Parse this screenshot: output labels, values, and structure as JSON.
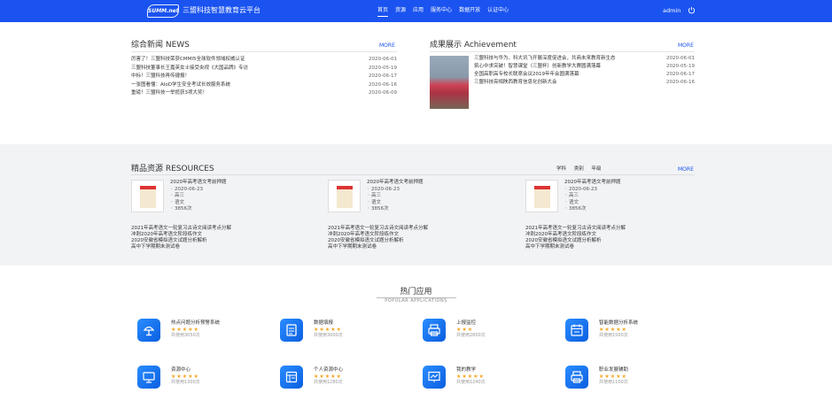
{
  "header": {
    "logo_text": "SUMM.net",
    "site_name": "三盟科技智慧教育云平台",
    "nav": [
      "首页",
      "资源",
      "应用",
      "服务中心",
      "数据开放",
      "认证中心"
    ],
    "active_nav": "首页",
    "user": "admin",
    "accent": "#1a53f0"
  },
  "news": {
    "title": "综合新闻 NEWS",
    "more": "MORE",
    "items": [
      {
        "title": "厉害了！三盟科技荣获CMMI5全球软件领域权威认证",
        "date": "2020-06-01"
      },
      {
        "title": "三盟科技董事长王嘉英女士接受央视《大国品牌》专访",
        "date": "2020-05-19"
      },
      {
        "title": "中标！三盟科技再传捷报！",
        "date": "2020-06-17"
      },
      {
        "title": "一张图看懂：AIoD学生安全考试长效服务系统",
        "date": "2020-06-16"
      },
      {
        "title": "重磅！三盟科技一举揽获3项大奖！",
        "date": "2020-06-09"
      }
    ]
  },
  "achievement": {
    "title": "成果展示 Achievement",
    "more": "MORE",
    "items": [
      {
        "title": "三盟科技与华为、科大讯飞开展深度促进会，共商未来教育新生态",
        "date": "2020-06-01"
      },
      {
        "title": "筑心中求突破！智慧课堂（三盟杯）创新教学大赛圆满落幕",
        "date": "2020-05-19"
      },
      {
        "title": "全国高职高专校长联席会议2019年年会圆满落幕",
        "date": "2020-06-17"
      },
      {
        "title": "三盟科技亮相陕西教育信息化创新大会",
        "date": "2020-06-16"
      }
    ]
  },
  "resources": {
    "title": "精品资源 RESOURCES",
    "filters": [
      "学科",
      "类别",
      "年级"
    ],
    "more": "MORE",
    "cards": [
      {
        "title": "2020年高考语文考前押题",
        "date": "2020-06-23",
        "grade": "高三",
        "subject": "语文",
        "views": "3856次",
        "links": [
          "2021年高考语文一轮复习古诗文阅读考点分解",
          "冲刺2020年高考语文阶段练作文",
          "2020安徽省模拟语文试题分析解析",
          "高中下学期期末测试卷"
        ]
      },
      {
        "title": "2020年高考语文考前押题",
        "date": "2020-06-23",
        "grade": "高三",
        "subject": "语文",
        "views": "3856次",
        "links": [
          "2021年高考语文一轮复习古诗文阅读考点分解",
          "冲刺2020年高考语文阶段练作文",
          "2020安徽省模拟语文试题分析解析",
          "高中下学期期末测试卷"
        ]
      },
      {
        "title": "2020年高考语文考前押题",
        "date": "2020-06-23",
        "grade": "高三",
        "subject": "语文",
        "views": "3856次",
        "links": [
          "2021年高考语文一轮复习古诗文阅读考点分解",
          "冲刺2020年高考语文阶段练作文",
          "2020安徽省模拟语文试题分析解析",
          "高中下学期期末测试卷"
        ]
      }
    ]
  },
  "hot_apps": {
    "title": "热门应用",
    "subtitle": "POPULAR APPLICATIONS",
    "apps": [
      {
        "name": "热点问题分析预警系统",
        "stars": "★★★★★",
        "rating": 5,
        "usage": "共使用3050次",
        "icon": "lamp-icon"
      },
      {
        "name": "数据填报",
        "stars": "★★★★★",
        "rating": 5,
        "usage": "共使用3000次",
        "icon": "form-fill-icon"
      },
      {
        "name": "上报监控",
        "stars": "★★★",
        "rating": 3,
        "usage": "共使用2800次",
        "icon": "printer-icon"
      },
      {
        "name": "智能数据分析系统",
        "stars": "★★★★★",
        "rating": 5,
        "usage": "共使用1500次",
        "icon": "calendar-icon"
      },
      {
        "name": "资源中心",
        "stars": "★★★★★",
        "rating": 5,
        "usage": "共使用1300次",
        "icon": "monitor-icon"
      },
      {
        "name": "个人资源中心",
        "stars": "★★★★★",
        "rating": 5,
        "usage": "共使用1280次",
        "icon": "document-grid-icon"
      },
      {
        "name": "我的教学",
        "stars": "★★★★★",
        "rating": 5,
        "usage": "共使用1240次",
        "icon": "presentation-icon"
      },
      {
        "name": "职业发展辅助",
        "stars": "★★★★★",
        "rating": 5,
        "usage": "共使用1100次",
        "icon": "printer-icon"
      }
    ]
  }
}
